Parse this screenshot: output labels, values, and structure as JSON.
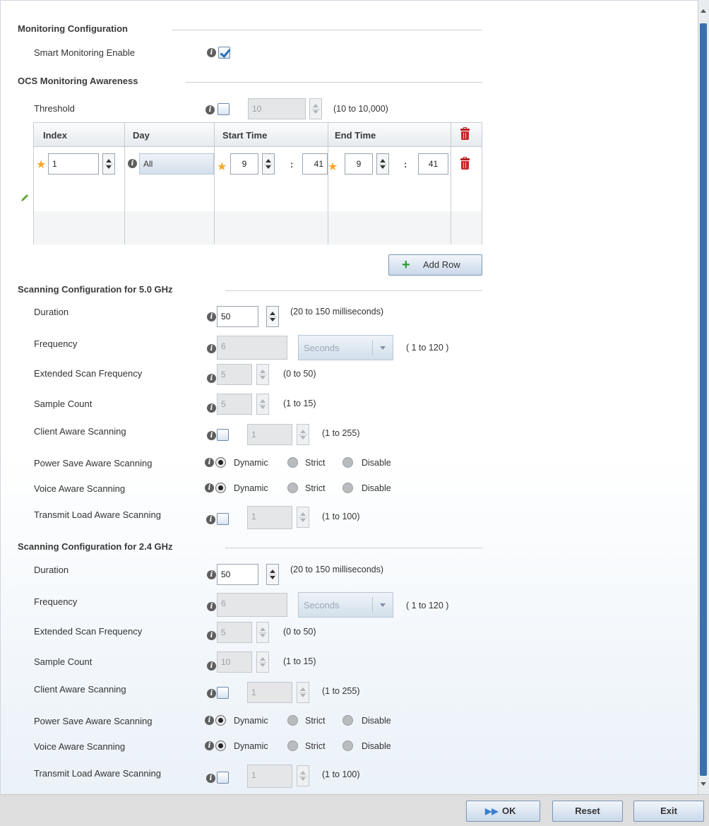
{
  "monitoring": {
    "title": "Monitoring Configuration",
    "smart_label": "Smart Monitoring Enable",
    "smart_checked": true
  },
  "ocs": {
    "title": "OCS Monitoring Awareness",
    "threshold_label": "Threshold",
    "threshold_value": "10",
    "threshold_hint": "(10 to 10,000)",
    "columns": [
      "Index",
      "Day",
      "Start Time",
      "End Time"
    ],
    "row": {
      "index": "1",
      "day": "All",
      "start_hour": "9",
      "start_sep": ":",
      "start_min": "41",
      "end_hour": "9",
      "end_sep": ":",
      "end_min": "41"
    },
    "add_row_label": "Add Row"
  },
  "scan5": {
    "title": "Scanning Configuration for 5.0 GHz",
    "duration_label": "Duration",
    "duration_value": "50",
    "duration_hint": "(20 to 150 milliseconds)",
    "frequency_label": "Frequency",
    "frequency_value": "6",
    "frequency_unit": "Seconds",
    "frequency_hint": "( 1 to 120 )",
    "ext_label": "Extended Scan Frequency",
    "ext_value": "5",
    "ext_hint": "(0 to 50)",
    "sample_label": "Sample Count",
    "sample_value": "5",
    "sample_hint": "(1 to 15)",
    "client_label": "Client Aware Scanning",
    "client_value": "1",
    "client_hint": "(1 to 255)",
    "power_label": "Power Save Aware Scanning",
    "voice_label": "Voice Aware Scanning",
    "transmit_label": "Transmit Load Aware Scanning",
    "transmit_value": "1",
    "transmit_hint": "(1 to 100)"
  },
  "scan24": {
    "title": "Scanning Configuration for 2.4 GHz",
    "duration_label": "Duration",
    "duration_value": "50",
    "duration_hint": "(20 to 150 milliseconds)",
    "frequency_label": "Frequency",
    "frequency_value": "6",
    "frequency_unit": "Seconds",
    "frequency_hint": "( 1 to 120 )",
    "ext_label": "Extended Scan Frequency",
    "ext_value": "5",
    "ext_hint": "(0 to 50)",
    "sample_label": "Sample Count",
    "sample_value": "10",
    "sample_hint": "(1 to 15)",
    "client_label": "Client Aware Scanning",
    "client_value": "1",
    "client_hint": "(1 to 255)",
    "power_label": "Power Save Aware Scanning",
    "voice_label": "Voice Aware Scanning",
    "transmit_label": "Transmit Load Aware Scanning",
    "transmit_value": "1",
    "transmit_hint": "(1 to 100)"
  },
  "radio_options": {
    "dynamic": "Dynamic",
    "strict": "Strict",
    "disable": "Disable"
  },
  "footer": {
    "ok": "OK",
    "reset": "Reset",
    "exit": "Exit"
  },
  "colors": {
    "accent": "#2a6fb5",
    "required_star": "#f7a72b",
    "delete_red": "#c62b2b",
    "add_green": "#2e9e2e"
  }
}
